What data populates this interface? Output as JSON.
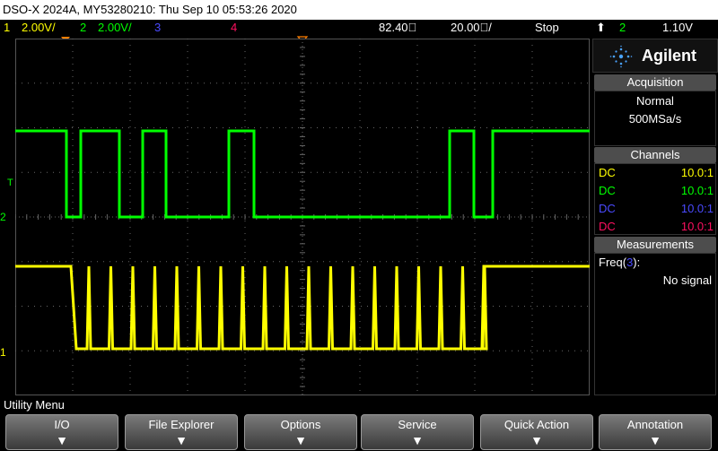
{
  "title_bar": "DSO-X 2024A, MY53280210: Thu Sep 10 05:53:26 2020",
  "status_bar": {
    "ch1_num": "1",
    "ch1_scale": "2.00V/",
    "ch2_num": "2",
    "ch2_scale": "2.00V/",
    "ch3_num": "3",
    "ch4_num": "4",
    "delay": "82.40ﾟ",
    "timebase": "20.00ﾟ/",
    "run_state": "Stop",
    "trigger_icon": "trigger-edge-icon",
    "trigger_channel": "2",
    "trigger_level": "1.10V"
  },
  "colors": {
    "ch1": "#ffff00",
    "ch2": "#00ff00",
    "ch3": "#4a4aff",
    "ch4": "#ff1060",
    "grid": "#666666",
    "panel_header": "#4d4d4d"
  },
  "brand": {
    "name": "Agilent"
  },
  "acquisition": {
    "header": "Acquisition",
    "mode": "Normal",
    "rate": "500MSa/s"
  },
  "channels": {
    "header": "Channels",
    "rows": [
      {
        "coupling": "DC",
        "probe": "10.0:1"
      },
      {
        "coupling": "DC",
        "probe": "10.0:1"
      },
      {
        "coupling": "DC",
        "probe": "10.0:1"
      },
      {
        "coupling": "DC",
        "probe": "10.0:1"
      }
    ]
  },
  "measurements": {
    "header": "Measurements",
    "label_prefix": "Freq(",
    "label_channel": "3",
    "label_suffix": "):",
    "value": "No signal"
  },
  "screen_markers": {
    "trigger_marker": "T",
    "ch2_ground": "2",
    "ch1_ground": "1"
  },
  "menu": {
    "title": "Utility Menu",
    "softkeys": [
      "I/O",
      "File Explorer",
      "Options",
      "Service",
      "Quick Action",
      "Annotation"
    ]
  }
}
